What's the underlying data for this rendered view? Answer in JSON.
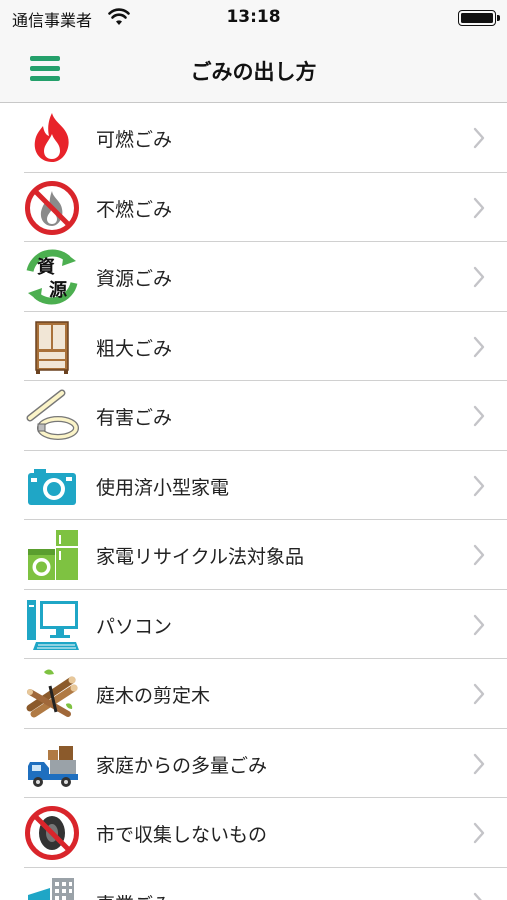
{
  "status": {
    "carrier": "通信事業者",
    "time": "13:18"
  },
  "nav": {
    "title": "ごみの出し方",
    "menu_icon": "hamburger-menu-icon"
  },
  "items": [
    {
      "label": "可燃ごみ",
      "icon": "fire-icon"
    },
    {
      "label": "不燃ごみ",
      "icon": "no-fire-icon"
    },
    {
      "label": "資源ごみ",
      "icon": "recycle-resource-icon",
      "icon_text_top": "資",
      "icon_text_bottom": "源"
    },
    {
      "label": "粗大ごみ",
      "icon": "cabinet-icon"
    },
    {
      "label": "有害ごみ",
      "icon": "fluorescent-lamp-icon"
    },
    {
      "label": "使用済小型家電",
      "icon": "camera-icon"
    },
    {
      "label": "家電リサイクル法対象品",
      "icon": "appliances-icon"
    },
    {
      "label": "パソコン",
      "icon": "computer-icon"
    },
    {
      "label": "庭木の剪定木",
      "icon": "branches-icon"
    },
    {
      "label": "家庭からの多量ごみ",
      "icon": "truck-icon"
    },
    {
      "label": "市で収集しないもの",
      "icon": "no-tire-icon"
    },
    {
      "label": "事業ごみ",
      "icon": "building-icon"
    }
  ],
  "colors": {
    "accent": "#24a06b",
    "prohibit": "#d9252b",
    "fire": "#e8232a",
    "recycle": "#4caf50",
    "wood": "#8b5a2b",
    "cyan": "#1fa6c6",
    "appliance": "#7ec241"
  }
}
